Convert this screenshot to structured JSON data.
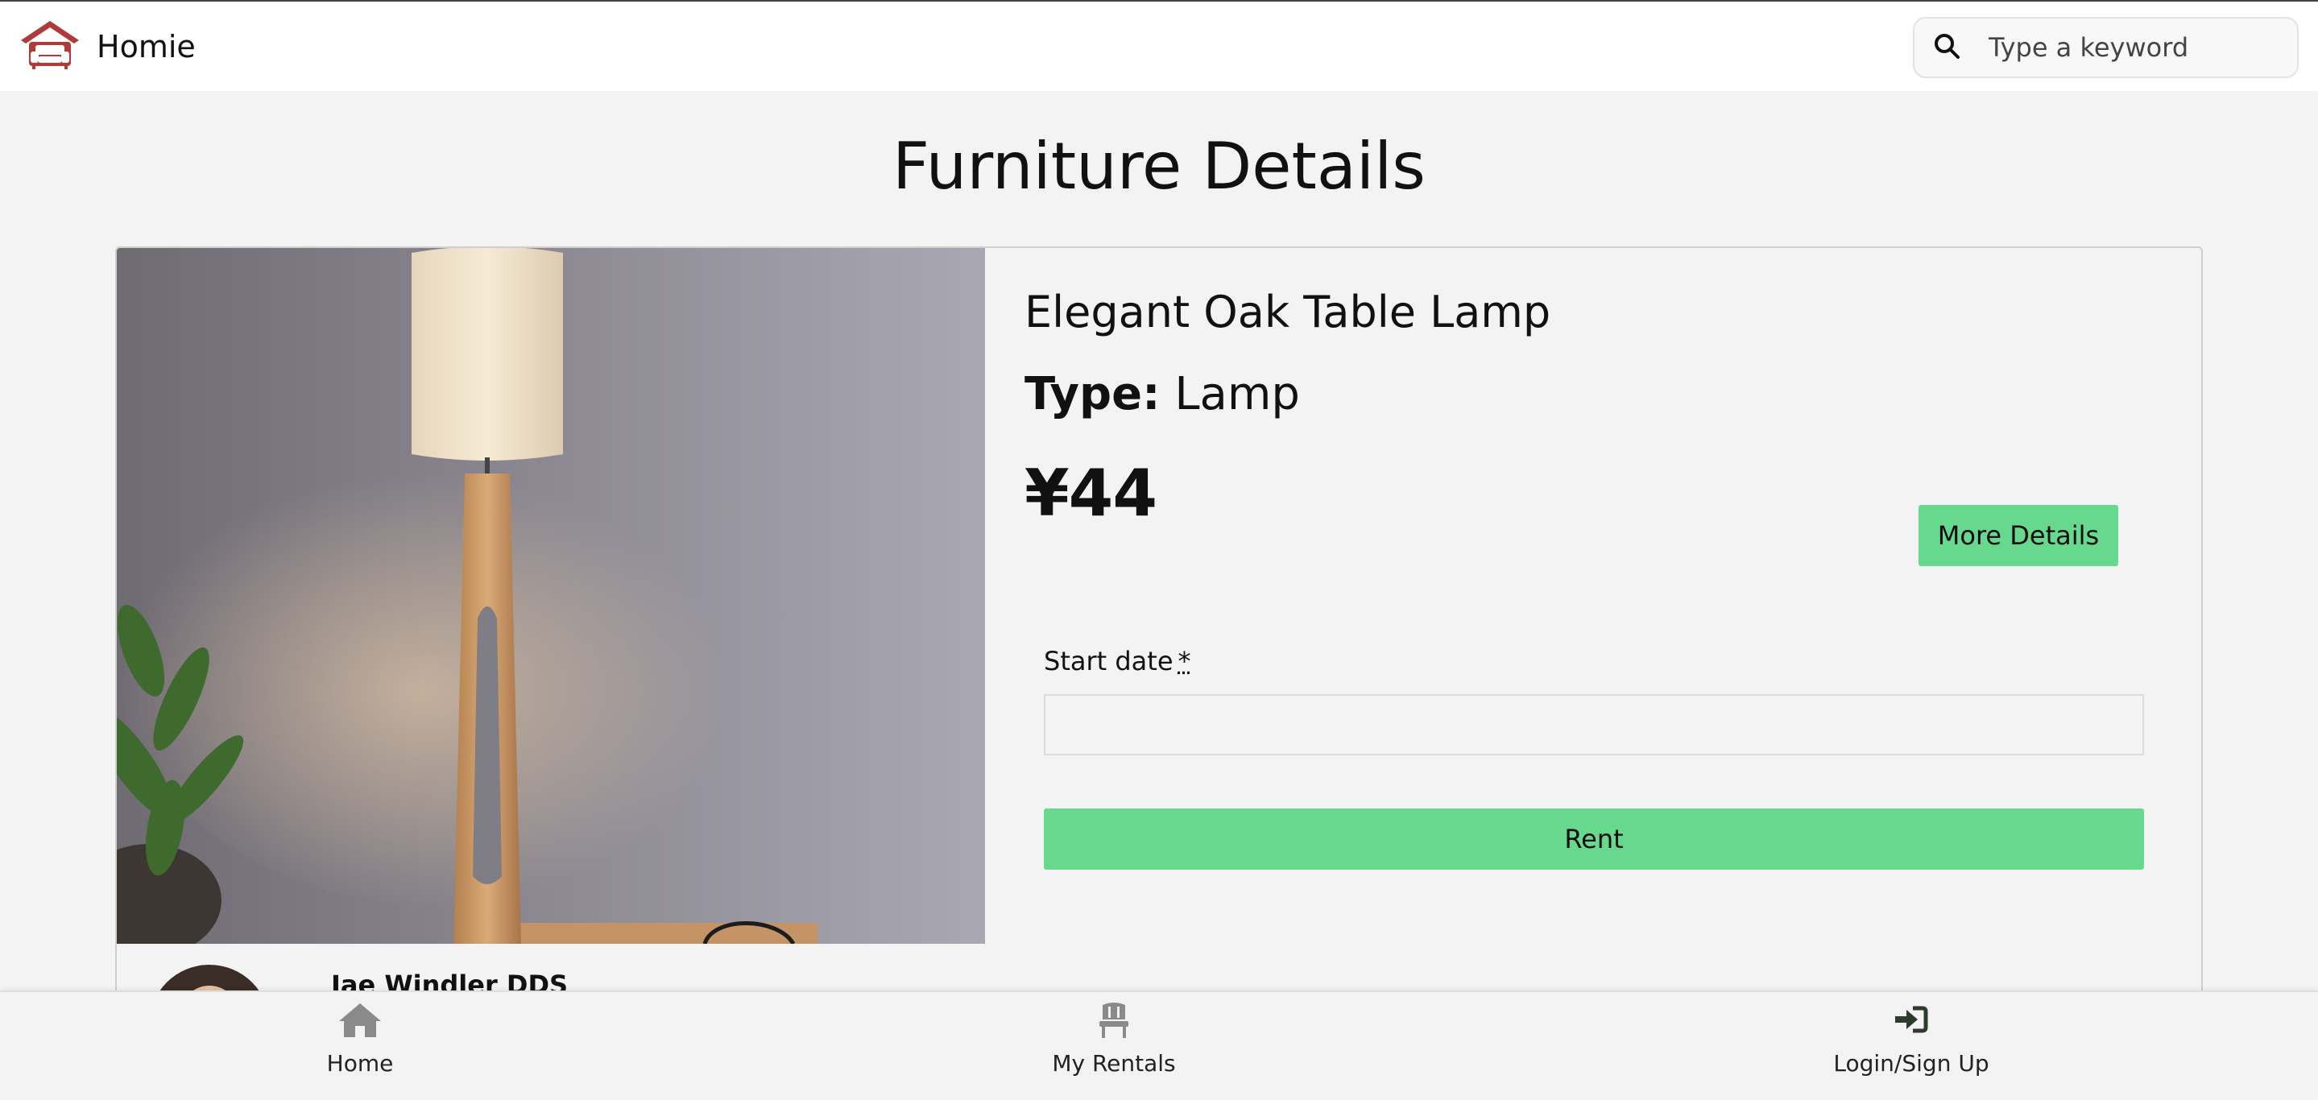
{
  "header": {
    "brand_name": "Homie",
    "logo_icon": "sofa-house-icon",
    "search_placeholder": "Type a keyword",
    "search_icon": "search-icon"
  },
  "page": {
    "title": "Furniture Details"
  },
  "product": {
    "name": "Elegant Oak Table Lamp",
    "type_label": "Type:",
    "type_value": "Lamp",
    "price": "¥44",
    "more_details_label": "More Details",
    "start_date_label": "Start date",
    "required_mark": "*",
    "start_date_value": "",
    "rent_label": "Rent"
  },
  "owner": {
    "name": "Jae Windler DDS"
  },
  "bottom_nav": {
    "items": [
      {
        "label": "Home",
        "icon": "home-icon"
      },
      {
        "label": "My Rentals",
        "icon": "chair-icon"
      },
      {
        "label": "Login/Sign Up",
        "icon": "login-icon"
      }
    ]
  },
  "colors": {
    "accent_green": "#67d98f",
    "brand_red": "#b03a3a",
    "page_background": "#f3f3f3"
  }
}
